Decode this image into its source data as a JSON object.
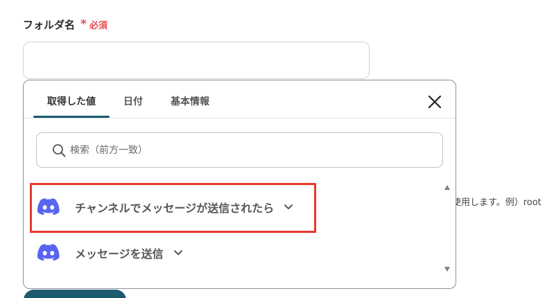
{
  "field": {
    "label": "フォルダ名",
    "asterisk": "*",
    "required": "必須",
    "value": ""
  },
  "helper_text": "使用します。例）root",
  "popup": {
    "tabs": [
      {
        "label": "取得した値",
        "active": true
      },
      {
        "label": "日付",
        "active": false
      },
      {
        "label": "基本情報",
        "active": false
      }
    ],
    "search": {
      "placeholder": "検索（前方一致）",
      "icon": "search-icon"
    },
    "items": [
      {
        "label": "チャンネルでメッセージが送信されたら",
        "icon": "discord-icon",
        "highlighted": true
      },
      {
        "label": "メッセージを送信",
        "icon": "discord-icon",
        "highlighted": false
      }
    ],
    "close_icon": "close-icon"
  },
  "colors": {
    "accent": "#19596d",
    "required": "#e64a55",
    "highlight": "#e8372c",
    "discord": "#5865f2"
  }
}
